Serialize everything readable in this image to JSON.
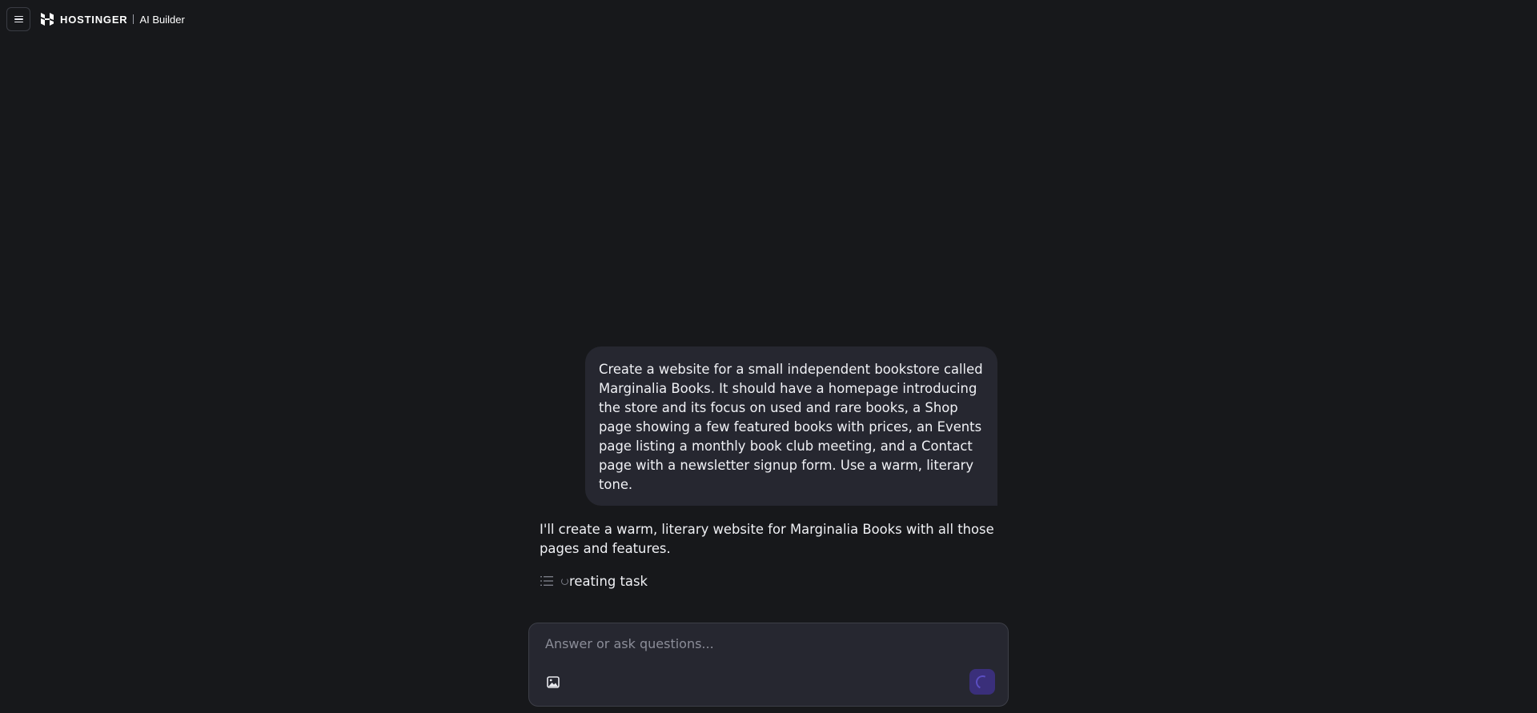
{
  "header": {
    "brand_name": "HOSTINGER",
    "product_name": "AI Builder"
  },
  "chat": {
    "user_message": "Create a website for a small independent bookstore called Marginalia Books. It should have a homepage introducing the store and its focus on used and rare books, a Shop page showing a few featured books with prices, an Events page listing a monthly book club meeting, and a Contact page with a newsletter signup form. Use a warm, literary tone.",
    "assistant_message": "I'll create a warm, literary website for Marginalia Books with all those pages and features.",
    "task_status": "reating task"
  },
  "composer": {
    "placeholder": "Answer or ask questions..."
  },
  "icons": {
    "menu": "hamburger-menu-icon",
    "logo": "hostinger-logo-icon",
    "task": "list-icon",
    "loading": "spinner-icon",
    "attach": "image-icon"
  },
  "colors": {
    "background": "#17181b",
    "bubble": "#262730",
    "send_button": "#3a2f7a",
    "accent": "#5b4ec2"
  }
}
